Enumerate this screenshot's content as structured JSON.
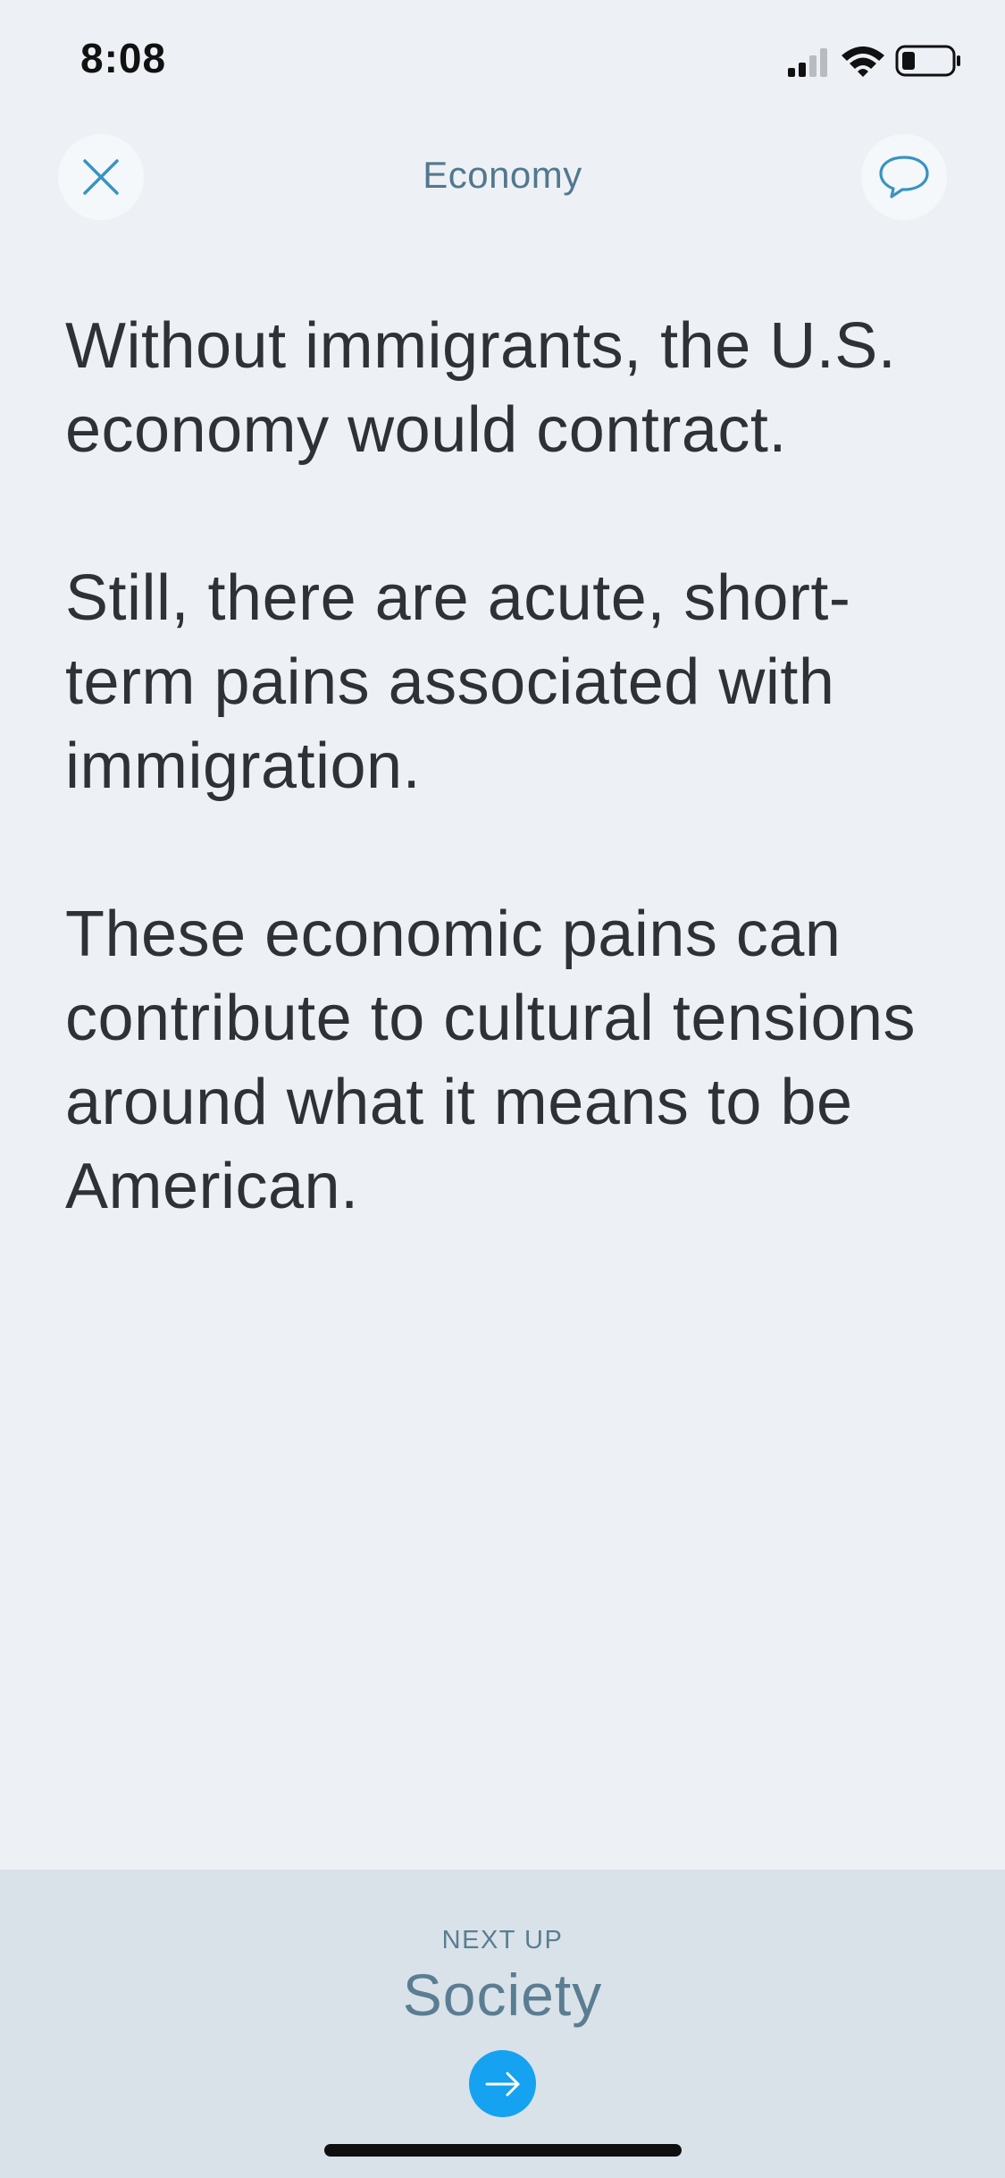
{
  "status_bar": {
    "time": "8:08",
    "icons": [
      "cellular-signal-icon",
      "wifi-icon",
      "battery-icon"
    ]
  },
  "header": {
    "title": "Economy",
    "close_icon": "close-icon",
    "comment_icon": "comment-icon"
  },
  "content": {
    "paragraphs": [
      "Without immigrants, the U.S. economy would contract.",
      "Still, there are acute, short-term pains associated with immigration.",
      "These economic pains can contribute to cultural tensions around what it means to be American."
    ]
  },
  "next_up": {
    "label": "NEXT UP",
    "title": "Society",
    "arrow_icon": "arrow-right-icon"
  },
  "colors": {
    "background": "#edf1f5",
    "accent": "#15a2f1",
    "header_text": "#52788f",
    "body_text": "#2e3136",
    "panel_bg": "#d9e2e9"
  }
}
